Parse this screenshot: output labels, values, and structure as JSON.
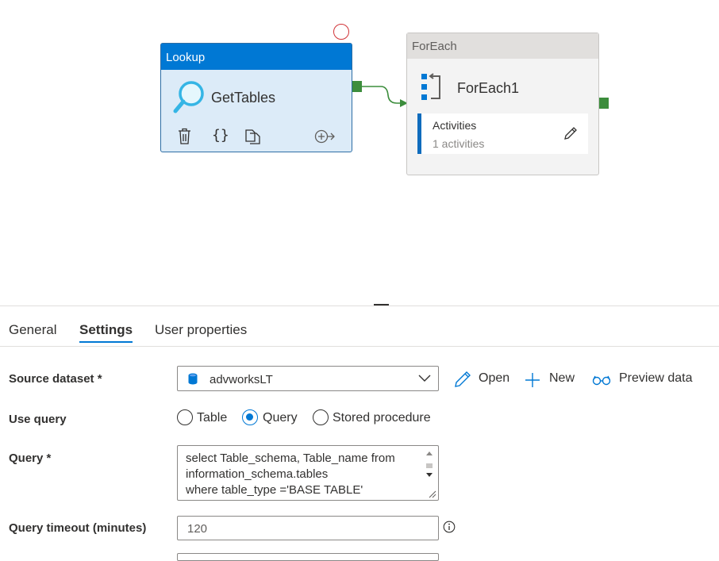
{
  "pipeline": {
    "lookup": {
      "type_label": "Lookup",
      "name": "GetTables"
    },
    "foreach": {
      "type_label": "ForEach",
      "name": "ForEach1",
      "activities_title": "Activities",
      "activities_count": "1 activities"
    }
  },
  "tabs": [
    {
      "label": "General",
      "active": false
    },
    {
      "label": "Settings",
      "active": true
    },
    {
      "label": "User properties",
      "active": false
    }
  ],
  "settings": {
    "source_dataset": {
      "label": "Source dataset",
      "required_mark": "*",
      "value": "advworksLT"
    },
    "actions": {
      "open": "Open",
      "new": "New",
      "preview": "Preview data"
    },
    "use_query": {
      "label": "Use query",
      "options": [
        "Table",
        "Query",
        "Stored procedure"
      ],
      "selected": "Query"
    },
    "query": {
      "label": "Query",
      "required_mark": "*",
      "lines": [
        "select Table_schema, Table_name from",
        "information_schema.tables",
        "where table_type ='BASE TABLE'"
      ]
    },
    "query_timeout": {
      "label": "Query timeout (minutes)",
      "value": "120"
    }
  },
  "colors": {
    "accent": "#0078d4",
    "success_port": "#3c8d3c",
    "error": "#d13438"
  }
}
